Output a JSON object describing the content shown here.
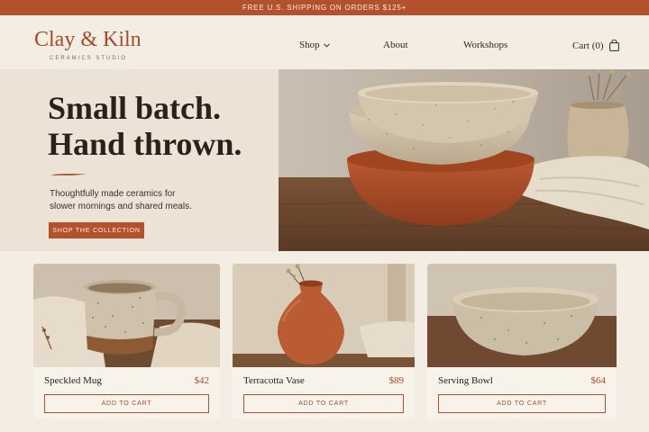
{
  "promo": {
    "text": "FREE U.S. SHIPPING ON ORDERS $125+"
  },
  "brand": {
    "name": "Clay & Kiln",
    "tagline": "CERAMICS STUDIO",
    "accent_color": "#b2512b"
  },
  "nav": {
    "shop": "Shop",
    "about": "About",
    "workshops": "Workshops",
    "cart": "Cart (0)"
  },
  "hero": {
    "title_line1": "Small batch.",
    "title_line2": "Hand thrown.",
    "copy_line1": "Thoughtfully made ceramics for",
    "copy_line2": "slower mornings and shared meals.",
    "cta": "SHOP THE COLLECTION"
  },
  "products": [
    {
      "name": "Speckled Mug",
      "price": "$42",
      "button": "ADD TO CART"
    },
    {
      "name": "Terracotta Vase",
      "price": "$89",
      "button": "ADD TO CART"
    },
    {
      "name": "Serving Bowl",
      "price": "$64",
      "button": "ADD TO CART"
    }
  ],
  "icons": {
    "shop_caret": "chevron-down-icon",
    "cart": "shopping-bag-icon",
    "rule": "brush-stroke"
  }
}
